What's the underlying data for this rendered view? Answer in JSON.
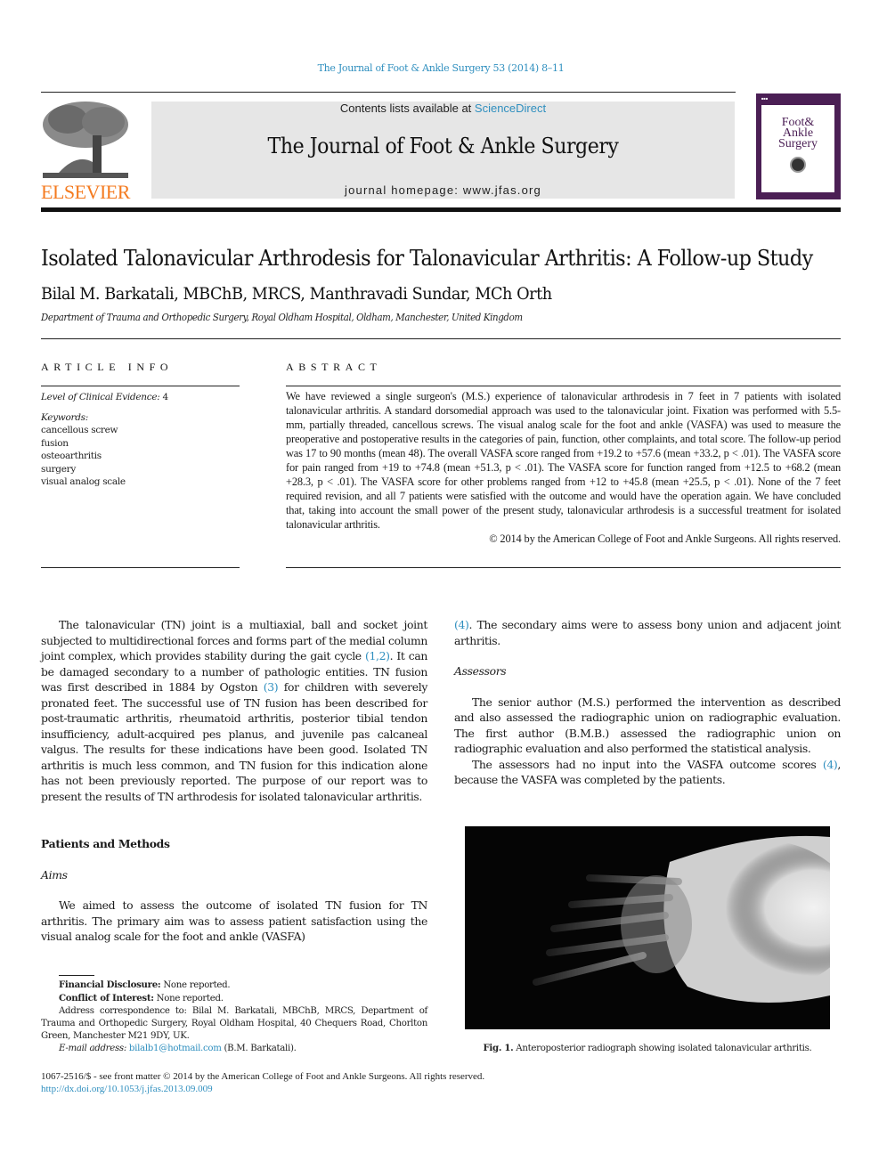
{
  "running_head": "The Journal of Foot & Ankle Surgery 53 (2014) 8–11",
  "masthead": {
    "publisher_logo": "ELSEVIER",
    "contents_prefix": "Contents lists available at ",
    "contents_link": "ScienceDirect",
    "journal_name": "The Journal of Foot & Ankle Surgery",
    "homepage_line": "journal homepage: www.jfas.org",
    "cover_title_lines": [
      "Foot&",
      "Ankle",
      "Surgery"
    ],
    "colors": {
      "link": "#2f8fbf",
      "elsevier_orange": "#f47b20",
      "cover_purple": "#4b1f55",
      "masthead_gray": "#e6e6e6"
    }
  },
  "article": {
    "title": "Isolated Talonavicular Arthrodesis for Talonavicular Arthritis: A Follow-up Study",
    "authors": "Bilal M. Barkatali, MBChB, MRCS, Manthravadi Sundar, MCh Orth",
    "affiliation": "Department of Trauma and Orthopedic Surgery, Royal Oldham Hospital, Oldham, Manchester, United Kingdom"
  },
  "article_info": {
    "heading": "ARTICLE INFO",
    "evidence_label": "Level of Clinical Evidence:",
    "evidence_value": " 4",
    "keywords_label": "Keywords:",
    "keywords": [
      "cancellous screw",
      "fusion",
      "osteoarthritis",
      "surgery",
      "visual analog scale"
    ]
  },
  "abstract": {
    "heading": "ABSTRACT",
    "text": "We have reviewed a single surgeon's (M.S.) experience of talonavicular arthrodesis in 7 feet in 7 patients with isolated talonavicular arthritis. A standard dorsomedial approach was used to the talonavicular joint. Fixation was performed with 5.5-mm, partially threaded, cancellous screws. The visual analog scale for the foot and ankle (VASFA) was used to measure the preoperative and postoperative results in the categories of pain, function, other complaints, and total score. The follow-up period was 17 to 90 months (mean 48). The overall VASFA score ranged from +19.2 to +57.6 (mean +33.2, p < .01). The VASFA score for pain ranged from +19 to +74.8 (mean +51.3, p < .01). The VASFA score for function ranged from +12.5 to +68.2 (mean +28.3, p < .01). The VASFA score for other problems ranged from +12 to +45.8 (mean +25.5, p < .01). None of the 7 feet required revision, and all 7 patients were satisfied with the outcome and would have the operation again. We have concluded that, taking into account the small power of the present study, talonavicular arthrodesis is a successful treatment for isolated talonavicular arthritis.",
    "copyright": "© 2014 by the American College of Foot and Ankle Surgeons. All rights reserved."
  },
  "body": {
    "intro_p1_a": "The talonavicular (TN) joint is a multiaxial, ball and socket joint subjected to multidirectional forces and forms part of the medial column joint complex, which provides stability during the gait cycle ",
    "intro_ref1": "(1,2)",
    "intro_p1_b": ". It can be damaged secondary to a number of pathologic entities. TN fusion was first described in 1884 by Ogston ",
    "intro_ref2": "(3)",
    "intro_p1_c": " for children with severely pronated feet. The successful use of TN fusion has been described for post-traumatic arthritis, rheumatoid arthritis, posterior tibial tendon insufficiency, adult-acquired pes planus, and juvenile pas calcaneal valgus. The results for these indications have been good. Isolated TN arthritis is much less common, and TN fusion for this indication alone has not been previously reported. The purpose of our report was to present the results of TN arthrodesis for isolated talonavicular arthritis.",
    "section_heading": "Patients and Methods",
    "aims_heading": "Aims",
    "aims_p_a": "We aimed to assess the outcome of isolated TN fusion for TN arthritis. The primary aim was to assess patient satisfaction using the visual analog scale for the foot and ankle (VASFA) ",
    "aims_ref": "(4)",
    "aims_p_b": ". The secondary aims were to assess bony union and adjacent joint arthritis.",
    "assessors_heading": "Assessors",
    "assessors_p1": "The senior author (M.S.) performed the intervention as described and also assessed the radiographic union on radiographic evaluation. The first author (B.M.B.) assessed the radiographic union on radiographic evaluation and also performed the statistical analysis.",
    "assessors_p2_a": "The assessors had no input into the VASFA outcome scores ",
    "assessors_ref": "(4)",
    "assessors_p2_b": ", because the VASFA was completed by the patients."
  },
  "footnotes": {
    "financial_label": "Financial Disclosure:",
    "financial_value": " None reported.",
    "conflict_label": "Conflict of Interest:",
    "conflict_value": " None reported.",
    "address": "Address correspondence to: Bilal M. Barkatali, MBChB, MRCS, Department of Trauma and Orthopedic Surgery, Royal Oldham Hospital, 40 Chequers Road, Chorlton Green, Manchester M21 9DY, UK.",
    "email_label": "E-mail address:",
    "email": "bilalb1@hotmail.com",
    "email_suffix": " (B.M. Barkatali)."
  },
  "figure": {
    "label": "Fig. 1.",
    "caption": " Anteroposterior radiograph showing isolated talonavicular arthritis."
  },
  "bottom": {
    "front_matter": "1067-2516/$ - see front matter © 2014 by the American College of Foot and Ankle Surgeons. All rights reserved.",
    "doi": "http://dx.doi.org/10.1053/j.jfas.2013.09.009"
  }
}
